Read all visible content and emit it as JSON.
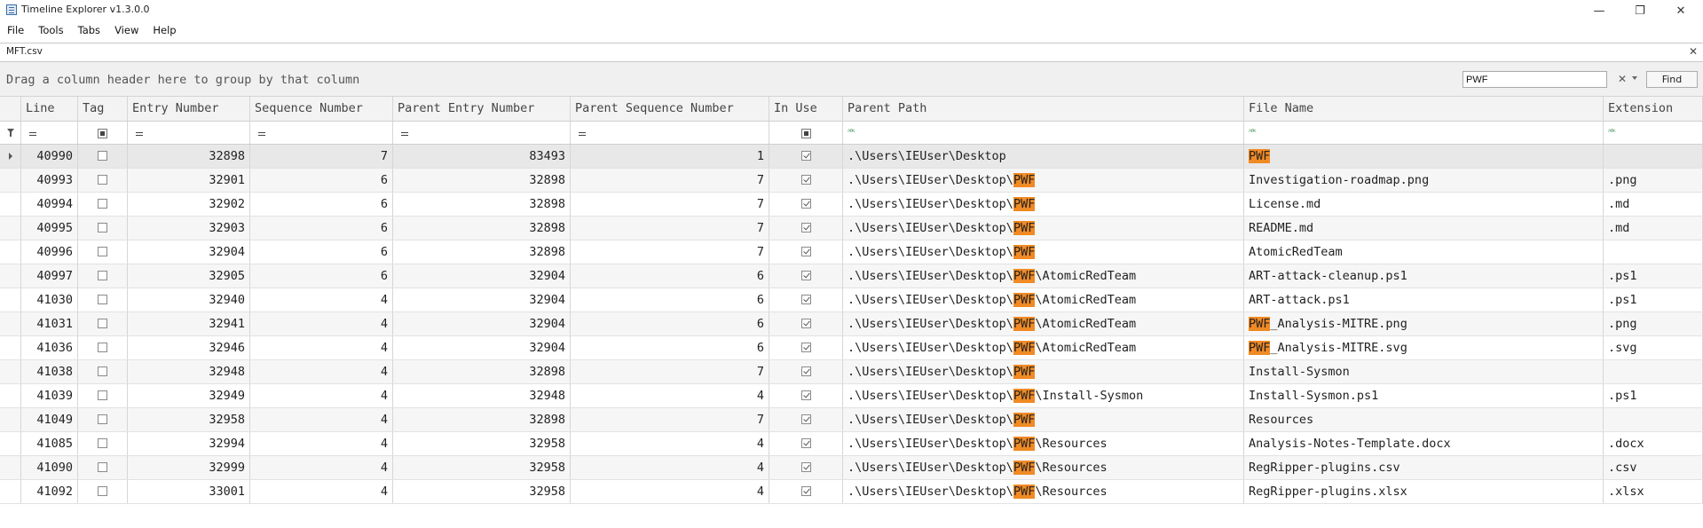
{
  "window": {
    "title": "Timeline Explorer v1.3.0.0",
    "controls": {
      "minimize": "—",
      "maximize": "❐",
      "close": "✕"
    }
  },
  "menu": [
    "File",
    "Tools",
    "Tabs",
    "View",
    "Help"
  ],
  "tab": {
    "label": "MFT.csv",
    "close": "✕"
  },
  "group_hint": "Drag a column header here to group by that column",
  "search": {
    "value": "PWF",
    "clear": "✕",
    "find_label": "Find"
  },
  "highlight": {
    "term": "PWF",
    "color": "#f08a24"
  },
  "columns": [
    "Line",
    "Tag",
    "Entry Number",
    "Sequence Number",
    "Parent Entry Number",
    "Parent Sequence Number",
    "In Use",
    "Parent Path",
    "File Name",
    "Extension"
  ],
  "rows": [
    {
      "line": "40990",
      "tag": false,
      "entry": "32898",
      "seq": "7",
      "pentry": "83493",
      "pseq": "1",
      "inuse": true,
      "ppath": ".\\Users\\IEUser\\Desktop",
      "fname": "PWF",
      "ext": ""
    },
    {
      "line": "40993",
      "tag": false,
      "entry": "32901",
      "seq": "6",
      "pentry": "32898",
      "pseq": "7",
      "inuse": true,
      "ppath": ".\\Users\\IEUser\\Desktop\\PWF",
      "fname": "Investigation-roadmap.png",
      "ext": ".png"
    },
    {
      "line": "40994",
      "tag": false,
      "entry": "32902",
      "seq": "6",
      "pentry": "32898",
      "pseq": "7",
      "inuse": true,
      "ppath": ".\\Users\\IEUser\\Desktop\\PWF",
      "fname": "License.md",
      "ext": ".md"
    },
    {
      "line": "40995",
      "tag": false,
      "entry": "32903",
      "seq": "6",
      "pentry": "32898",
      "pseq": "7",
      "inuse": true,
      "ppath": ".\\Users\\IEUser\\Desktop\\PWF",
      "fname": "README.md",
      "ext": ".md"
    },
    {
      "line": "40996",
      "tag": false,
      "entry": "32904",
      "seq": "6",
      "pentry": "32898",
      "pseq": "7",
      "inuse": true,
      "ppath": ".\\Users\\IEUser\\Desktop\\PWF",
      "fname": "AtomicRedTeam",
      "ext": ""
    },
    {
      "line": "40997",
      "tag": false,
      "entry": "32905",
      "seq": "6",
      "pentry": "32904",
      "pseq": "6",
      "inuse": true,
      "ppath": ".\\Users\\IEUser\\Desktop\\PWF\\AtomicRedTeam",
      "fname": "ART-attack-cleanup.ps1",
      "ext": ".ps1"
    },
    {
      "line": "41030",
      "tag": false,
      "entry": "32940",
      "seq": "4",
      "pentry": "32904",
      "pseq": "6",
      "inuse": true,
      "ppath": ".\\Users\\IEUser\\Desktop\\PWF\\AtomicRedTeam",
      "fname": "ART-attack.ps1",
      "ext": ".ps1"
    },
    {
      "line": "41031",
      "tag": false,
      "entry": "32941",
      "seq": "4",
      "pentry": "32904",
      "pseq": "6",
      "inuse": true,
      "ppath": ".\\Users\\IEUser\\Desktop\\PWF\\AtomicRedTeam",
      "fname": "PWF_Analysis-MITRE.png",
      "ext": ".png"
    },
    {
      "line": "41036",
      "tag": false,
      "entry": "32946",
      "seq": "4",
      "pentry": "32904",
      "pseq": "6",
      "inuse": true,
      "ppath": ".\\Users\\IEUser\\Desktop\\PWF\\AtomicRedTeam",
      "fname": "PWF_Analysis-MITRE.svg",
      "ext": ".svg"
    },
    {
      "line": "41038",
      "tag": false,
      "entry": "32948",
      "seq": "4",
      "pentry": "32898",
      "pseq": "7",
      "inuse": true,
      "ppath": ".\\Users\\IEUser\\Desktop\\PWF",
      "fname": "Install-Sysmon",
      "ext": ""
    },
    {
      "line": "41039",
      "tag": false,
      "entry": "32949",
      "seq": "4",
      "pentry": "32948",
      "pseq": "4",
      "inuse": true,
      "ppath": ".\\Users\\IEUser\\Desktop\\PWF\\Install-Sysmon",
      "fname": "Install-Sysmon.ps1",
      "ext": ".ps1"
    },
    {
      "line": "41049",
      "tag": false,
      "entry": "32958",
      "seq": "4",
      "pentry": "32898",
      "pseq": "7",
      "inuse": true,
      "ppath": ".\\Users\\IEUser\\Desktop\\PWF",
      "fname": "Resources",
      "ext": ""
    },
    {
      "line": "41085",
      "tag": false,
      "entry": "32994",
      "seq": "4",
      "pentry": "32958",
      "pseq": "4",
      "inuse": true,
      "ppath": ".\\Users\\IEUser\\Desktop\\PWF\\Resources",
      "fname": "Analysis-Notes-Template.docx",
      "ext": ".docx"
    },
    {
      "line": "41090",
      "tag": false,
      "entry": "32999",
      "seq": "4",
      "pentry": "32958",
      "pseq": "4",
      "inuse": true,
      "ppath": ".\\Users\\IEUser\\Desktop\\PWF\\Resources",
      "fname": "RegRipper-plugins.csv",
      "ext": ".csv"
    },
    {
      "line": "41092",
      "tag": false,
      "entry": "33001",
      "seq": "4",
      "pentry": "32958",
      "pseq": "4",
      "inuse": true,
      "ppath": ".\\Users\\IEUser\\Desktop\\PWF\\Resources",
      "fname": "RegRipper-plugins.xlsx",
      "ext": ".xlsx"
    }
  ]
}
